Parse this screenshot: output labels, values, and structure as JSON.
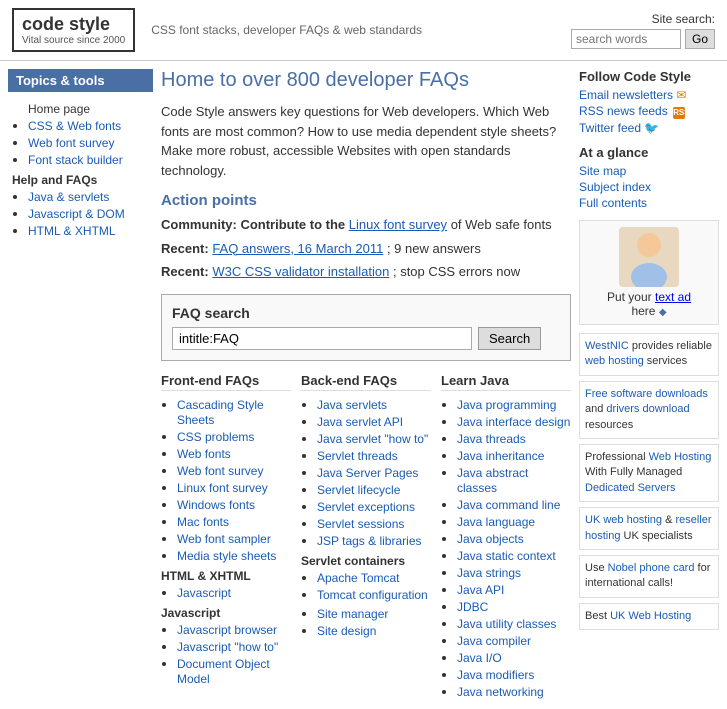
{
  "header": {
    "logo_title": "code style",
    "logo_subtitle": "Vital source since 2000",
    "tagline": "CSS font stacks, developer FAQs & web standards",
    "site_search_label": "Site search:",
    "search_placeholder": "search words",
    "go_label": "Go"
  },
  "sidebar": {
    "topics_label": "Topics & tools",
    "home_item": "Home page",
    "items": [
      {
        "label": "CSS & Web fonts",
        "href": "#"
      },
      {
        "label": "Web font survey",
        "href": "#"
      },
      {
        "label": "Font stack builder",
        "href": "#"
      }
    ],
    "help_label": "Help and FAQs",
    "help_items": [
      {
        "label": "Java & servlets",
        "href": "#"
      },
      {
        "label": "Javascript & DOM",
        "href": "#"
      },
      {
        "label": "HTML & XHTML",
        "href": "#"
      }
    ]
  },
  "main": {
    "page_title": "Home to over 800 developer FAQs",
    "intro": "Code Style answers key questions for Web developers. Which Web fonts are most common? How to use media dependent style sheets? Make more robust, accessible Websites with open standards technology.",
    "action_points_heading": "Action points",
    "community_text": "Community: Contribute to the",
    "community_link": "Linux font survey",
    "community_suffix": "of Web safe fonts",
    "recent1_prefix": "Recent:",
    "recent1_link": "FAQ answers, 16 March 2011",
    "recent1_suffix": "; 9 new answers",
    "recent2_prefix": "Recent:",
    "recent2_link": "W3C CSS validator installation",
    "recent2_suffix": "; stop CSS errors now",
    "faq_search_heading": "FAQ search",
    "faq_input_value": "intitle:FAQ",
    "faq_search_btn": "Search"
  },
  "faq_columns": {
    "frontend": {
      "heading": "Front-end FAQs",
      "items": [
        {
          "label": "Cascading Style Sheets",
          "href": "#"
        },
        {
          "label": "CSS problems",
          "href": "#"
        },
        {
          "label": "Web fonts",
          "href": "#"
        },
        {
          "label": "Web font survey",
          "href": "#"
        },
        {
          "label": "Linux font survey",
          "href": "#"
        },
        {
          "label": "Windows fonts",
          "href": "#"
        },
        {
          "label": "Mac fonts",
          "href": "#"
        },
        {
          "label": "Web font sampler",
          "href": "#"
        },
        {
          "label": "Media style sheets",
          "href": "#"
        }
      ],
      "subsections": [
        {
          "label": "HTML & XHTML",
          "items": [
            {
              "label": "Javascript",
              "href": "#"
            }
          ]
        },
        {
          "label": "Javascript",
          "items": [
            {
              "label": "Javascript browser",
              "href": "#"
            },
            {
              "label": "Javascript \"how to\"",
              "href": "#"
            },
            {
              "label": "Document Object Model",
              "href": "#"
            }
          ]
        }
      ]
    },
    "backend": {
      "heading": "Back-end FAQs",
      "items": [
        {
          "label": "Java servlets",
          "href": "#"
        },
        {
          "label": "Java servlet API",
          "href": "#"
        },
        {
          "label": "Java servlet \"how to\"",
          "href": "#"
        },
        {
          "label": "Servlet threads",
          "href": "#"
        },
        {
          "label": "Java Server Pages",
          "href": "#"
        },
        {
          "label": "Servlet lifecycle",
          "href": "#"
        },
        {
          "label": "Servlet exceptions",
          "href": "#"
        },
        {
          "label": "Servlet sessions",
          "href": "#"
        },
        {
          "label": "JSP tags & libraries",
          "href": "#"
        }
      ],
      "subsections": [
        {
          "label": "Servlet containers",
          "items": [
            {
              "label": "Apache Tomcat",
              "href": "#"
            },
            {
              "label": "Tomcat configuration",
              "href": "#"
            }
          ]
        },
        {
          "label": "",
          "items": [
            {
              "label": "Site manager",
              "href": "#"
            },
            {
              "label": "Site design",
              "href": "#"
            }
          ]
        }
      ]
    },
    "java": {
      "heading": "Learn Java",
      "items": [
        {
          "label": "Java programming",
          "href": "#"
        },
        {
          "label": "Java interface design",
          "href": "#"
        },
        {
          "label": "Java threads",
          "href": "#"
        },
        {
          "label": "Java inheritance",
          "href": "#"
        },
        {
          "label": "Java abstract classes",
          "href": "#"
        },
        {
          "label": "Java command line",
          "href": "#"
        },
        {
          "label": "Java language",
          "href": "#"
        },
        {
          "label": "Java objects",
          "href": "#"
        },
        {
          "label": "Java static context",
          "href": "#"
        },
        {
          "label": "Java strings",
          "href": "#"
        },
        {
          "label": "Java API",
          "href": "#"
        },
        {
          "label": "JDBC",
          "href": "#"
        },
        {
          "label": "Java utility classes",
          "href": "#"
        },
        {
          "label": "Java compiler",
          "href": "#"
        },
        {
          "label": "Java I/O",
          "href": "#"
        },
        {
          "label": "Java modifiers",
          "href": "#"
        },
        {
          "label": "Java networking",
          "href": "#"
        }
      ]
    }
  },
  "right_sidebar": {
    "follow_heading": "Follow Code Style",
    "follow_items": [
      {
        "label": "Email newsletters",
        "icon": "email"
      },
      {
        "label": "RSS news feeds",
        "icon": "rss"
      },
      {
        "label": "Twitter feed",
        "icon": "twitter"
      }
    ],
    "glance_heading": "At a glance",
    "glance_items": [
      {
        "label": "Site map"
      },
      {
        "label": "Subject index"
      },
      {
        "label": "Full contents"
      }
    ],
    "baby_ad_text": "Put your",
    "baby_ad_link": "text ad",
    "baby_ad_suffix": "here",
    "ads": [
      {
        "text": "WestNIC provides reliable web hosting services",
        "link1": "WestNIC",
        "link2": "web hosting"
      },
      {
        "text": "Free software downloads and drivers download resources",
        "link1": "Free software downloads",
        "link2": "drivers download"
      },
      {
        "text": "Professional Web Hosting With Fully Managed Dedicated Servers",
        "link1": "Web Hosting",
        "link2": "Dedicated Servers"
      },
      {
        "text": "UK web hosting & reseller hosting UK specialists",
        "link1": "UK web hosting",
        "link2": "reseller hosting"
      },
      {
        "text": "Use Nobel phone card for international calls!",
        "link1": "Nobel phone card"
      },
      {
        "text": "Best UK Web Hosting",
        "link1": "UK Web Hosting"
      }
    ]
  }
}
